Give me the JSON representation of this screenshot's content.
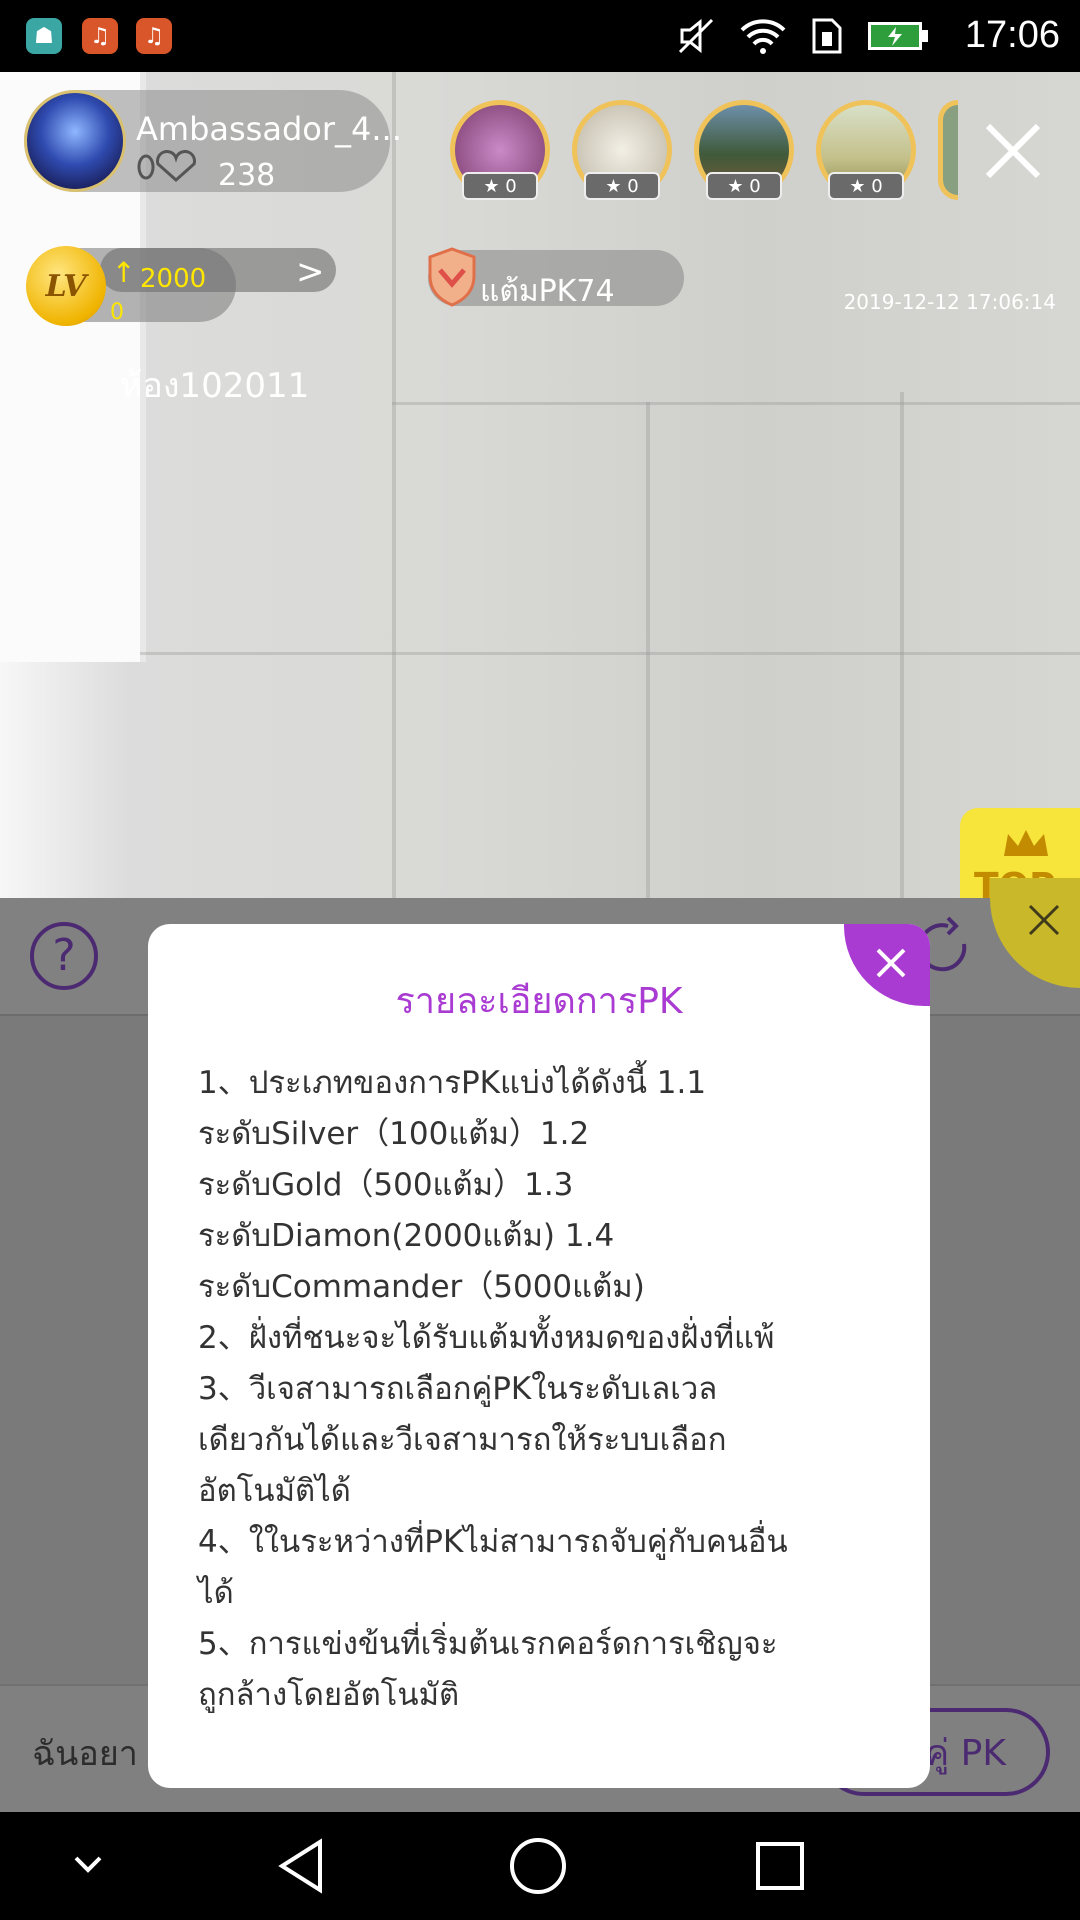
{
  "status_bar": {
    "time": "17:06",
    "app_icons": [
      "android-icon",
      "music-icon",
      "music-icon"
    ]
  },
  "host": {
    "name": "Ambassador_4...",
    "like_count": "238"
  },
  "top_fans": [
    {
      "badge": "0"
    },
    {
      "badge": "0"
    },
    {
      "badge": "0"
    },
    {
      "badge": "0"
    }
  ],
  "level": {
    "badge": "LV",
    "value": "2000",
    "sub_value": "0"
  },
  "pk_points": "แต้มPK74",
  "timestamp": "2019-12-12 17:06:14",
  "room": "ห้อง102011",
  "top_badge": "TOP",
  "modal": {
    "title": "รายละเอียดการPK",
    "lines": [
      "1、ประเภทของการPKแบ่งได้ดังนี้ 1.1",
      "ระดับSilver（100แต้ม）1.2",
      "ระดับGold（500แต้ม）1.3",
      "ระดับDiamon(2000แต้ม) 1.4",
      "ระดับCommander（5000แต้ม)",
      "2、ฝั่งที่ชนะจะได้รับแต้มทั้งหมดของฝั่งที่แพ้",
      "3、วีเจสามารถเลือกคู่PKในระดับเลเวล\nเดียวกันได้และวีเจสามารถให้ระบบเลือก\nอัตโนมัติได้",
      "4、ใในระหว่างที่PKไม่สามารถจับคู่กับคนอื่น\nได้",
      "5、การแข่งข้นที่เริ่มต้นเรกคอร์ดการเชิญจะ\nถูกล้างโดยอัตโนมัติ"
    ]
  },
  "bottom": {
    "input_text": "ฉันอยา",
    "match_button": "คู่ PK"
  },
  "colors": {
    "accent_purple": "#a93ad2",
    "dark_purple": "#4b2a72",
    "gold": "#f0c25a"
  }
}
